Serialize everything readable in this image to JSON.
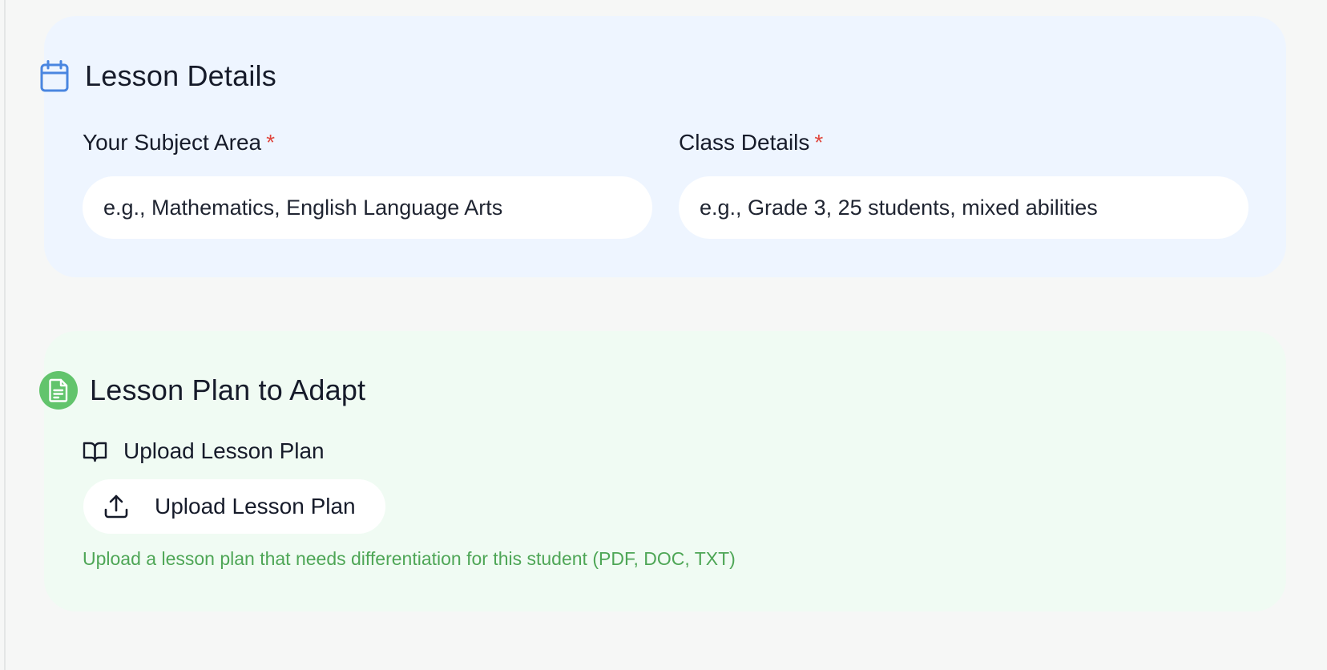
{
  "lesson_details": {
    "title": "Lesson Details",
    "icon": "calendar-icon",
    "accent_color": "#4a86e0",
    "background_color": "#eef5ff",
    "subject_area": {
      "label": "Your Subject Area",
      "required_marker": "*",
      "value": "",
      "placeholder": "e.g., Mathematics, English Language Arts"
    },
    "class_details": {
      "label": "Class Details",
      "required_marker": "*",
      "value": "",
      "placeholder": "e.g., Grade 3, 25 students, mixed abilities"
    }
  },
  "lesson_plan": {
    "title": "Lesson Plan to Adapt",
    "icon": "document-icon",
    "accent_color": "#62c46c",
    "background_color": "#f0fbf3",
    "upload_label": {
      "icon": "book-open-icon",
      "text": "Upload Lesson Plan"
    },
    "upload_button": {
      "icon": "upload-icon",
      "label": "Upload Lesson Plan"
    },
    "helper_text": "Upload a lesson plan that needs differentiation for this student (PDF, DOC, TXT)"
  },
  "colors": {
    "required": "#e0473e",
    "helper_text": "#4ea656",
    "text_primary": "#161b2a"
  }
}
